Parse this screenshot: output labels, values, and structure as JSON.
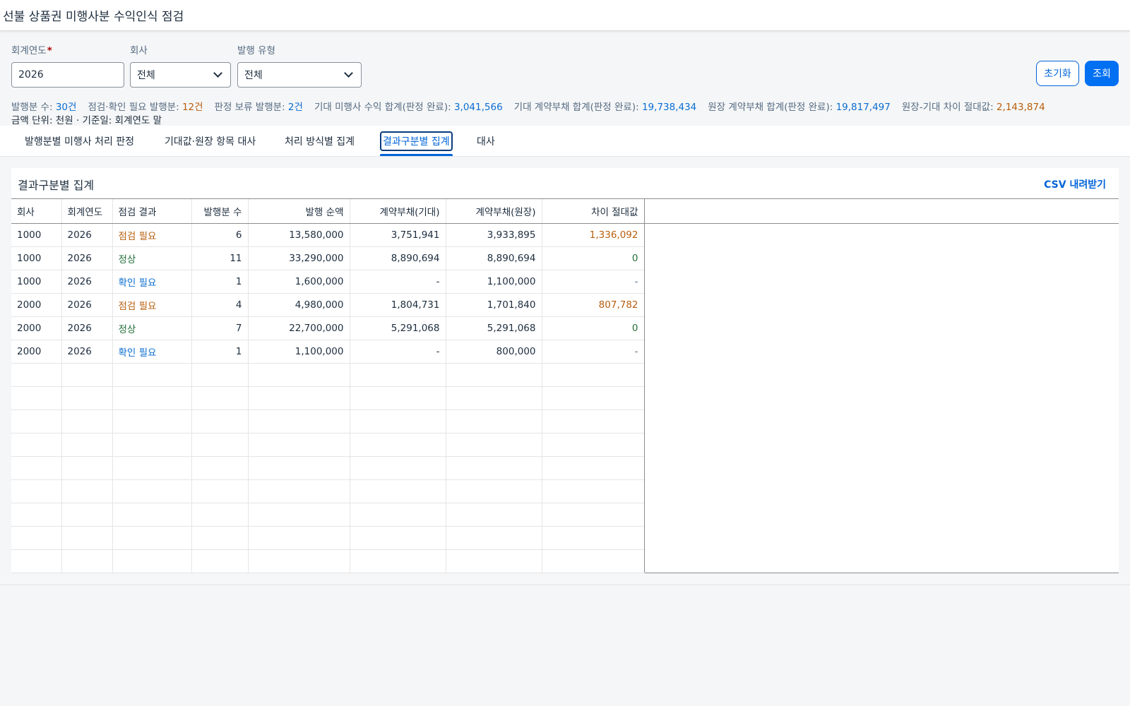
{
  "app": {
    "title": "선불 상품권 미행사분 수익인식 점검"
  },
  "filters": {
    "fiscal_year": {
      "label": "회계연도",
      "required_mark": "*",
      "value": "2026"
    },
    "company": {
      "label": "회사",
      "value": "전체"
    },
    "issue_type": {
      "label": "발행 유형",
      "value": "전체"
    },
    "reset_label": "초기화",
    "search_label": "조회"
  },
  "kpis": [
    {
      "label": "발행분 수:",
      "value": "30건",
      "tone": "blue"
    },
    {
      "label": "점검·확인 필요 발행분:",
      "value": "12건",
      "tone": "orange"
    },
    {
      "label": "판정 보류 발행분:",
      "value": "2건",
      "tone": "blue"
    },
    {
      "label": "기대 미행사 수익 합계(판정 완료):",
      "value": "3,041,566",
      "tone": "blue"
    },
    {
      "label": "기대 계약부채 합계(판정 완료):",
      "value": "19,738,434",
      "tone": "blue"
    },
    {
      "label": "원장 계약부채 합계(판정 완료):",
      "value": "19,817,497",
      "tone": "blue"
    },
    {
      "label": "원장-기대 차이 절대값:",
      "value": "2,143,874",
      "tone": "orange"
    }
  ],
  "unit_note": "금액 단위: 천원 · 기준일: 회계연도 말",
  "tabs": [
    {
      "label": "발행분별 미행사 처리 판정",
      "selected": false
    },
    {
      "label": "기대값·원장 항목 대사",
      "selected": false
    },
    {
      "label": "처리 방식별 집계",
      "selected": false
    },
    {
      "label": "결과구분별 집계",
      "selected": true
    },
    {
      "label": "대사",
      "selected": false
    }
  ],
  "panel": {
    "title": "결과구분별 집계",
    "csv_label": "CSV 내려받기",
    "columns": [
      "회사",
      "회계연도",
      "점검 결과",
      "발행분 수",
      "발행 순액",
      "계약부채(기대)",
      "계약부채(원장)",
      "차이 절대값"
    ],
    "rows": [
      {
        "company": "1000",
        "year": "2026",
        "result": "점검 필요",
        "result_tone": "orange",
        "count": "6",
        "net": "13,580,000",
        "expected": "3,751,941",
        "ledger": "3,933,895",
        "diff": "1,336,092",
        "diff_tone": "orange"
      },
      {
        "company": "1000",
        "year": "2026",
        "result": "정상",
        "result_tone": "green",
        "count": "11",
        "net": "33,290,000",
        "expected": "8,890,694",
        "ledger": "8,890,694",
        "diff": "0",
        "diff_tone": "green"
      },
      {
        "company": "1000",
        "year": "2026",
        "result": "확인 필요",
        "result_tone": "blue",
        "count": "1",
        "net": "1,600,000",
        "expected": "-",
        "ledger": "1,100,000",
        "diff": "-",
        "diff_tone": "gray"
      },
      {
        "company": "2000",
        "year": "2026",
        "result": "점검 필요",
        "result_tone": "orange",
        "count": "4",
        "net": "4,980,000",
        "expected": "1,804,731",
        "ledger": "1,701,840",
        "diff": "807,782",
        "diff_tone": "orange"
      },
      {
        "company": "2000",
        "year": "2026",
        "result": "정상",
        "result_tone": "green",
        "count": "7",
        "net": "22,700,000",
        "expected": "5,291,068",
        "ledger": "5,291,068",
        "diff": "0",
        "diff_tone": "green"
      },
      {
        "company": "2000",
        "year": "2026",
        "result": "확인 필요",
        "result_tone": "blue",
        "count": "1",
        "net": "1,100,000",
        "expected": "-",
        "ledger": "800,000",
        "diff": "-",
        "diff_tone": "gray"
      }
    ]
  },
  "colors": {
    "accent": "#0064d9",
    "orange": "#b85e0c",
    "green": "#256f3a",
    "blue": "#0a6ed1"
  }
}
